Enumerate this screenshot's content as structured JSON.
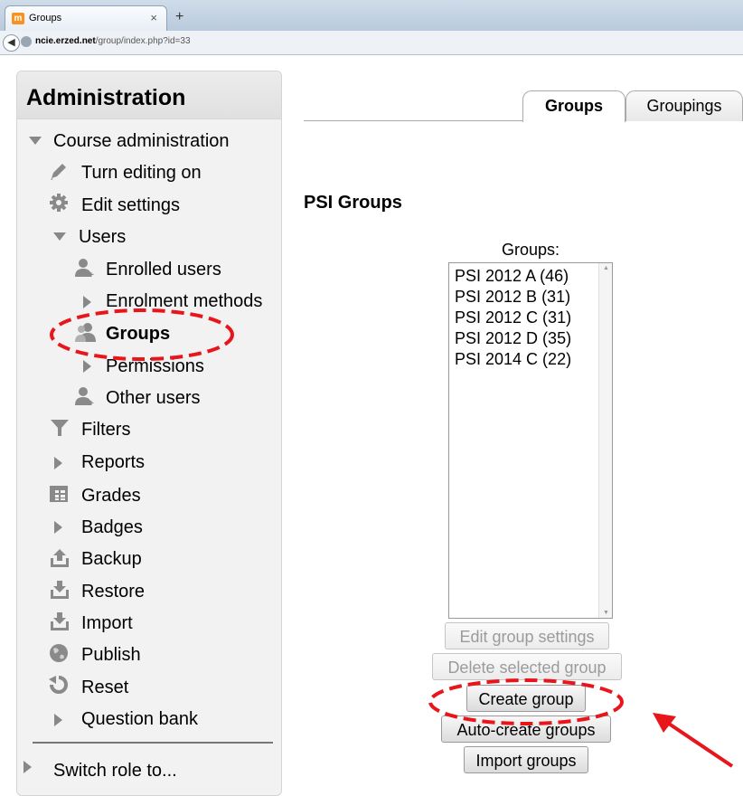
{
  "browser": {
    "tab_title": "Groups",
    "tab_close": "×",
    "new_tab": "+",
    "url_host": "ncie.erzed.net",
    "url_path": "/group/index.php?id=33"
  },
  "sidebar": {
    "title": "Administration",
    "items": {
      "course_admin": "Course administration",
      "turn_editing": "Turn editing on",
      "edit_settings": "Edit settings",
      "users": "Users",
      "enrolled_users": "Enrolled users",
      "enrolment_methods": "Enrolment methods",
      "groups": "Groups",
      "permissions": "Permissions",
      "other_users": "Other users",
      "filters": "Filters",
      "reports": "Reports",
      "grades": "Grades",
      "badges": "Badges",
      "backup": "Backup",
      "restore": "Restore",
      "import": "Import",
      "publish": "Publish",
      "reset": "Reset",
      "question_bank": "Question bank",
      "switch_role": "Switch role to..."
    }
  },
  "main": {
    "tabs": {
      "groups": "Groups",
      "groupings": "Groupings"
    },
    "heading": "PSI Groups",
    "groups_label": "Groups:",
    "groups_list": [
      "PSI 2012 A (46)",
      "PSI 2012 B (31)",
      "PSI 2012 C (31)",
      "PSI 2012 D (35)",
      "PSI 2014 C (22)"
    ],
    "buttons": {
      "edit_group_settings": "Edit group settings",
      "delete_selected_group": "Delete selected group",
      "create_group": "Create group",
      "auto_create_groups": "Auto-create groups",
      "import_groups": "Import groups"
    }
  },
  "colors": {
    "annotation": "#e8151b",
    "icon_grey": "#8a8a8a"
  }
}
